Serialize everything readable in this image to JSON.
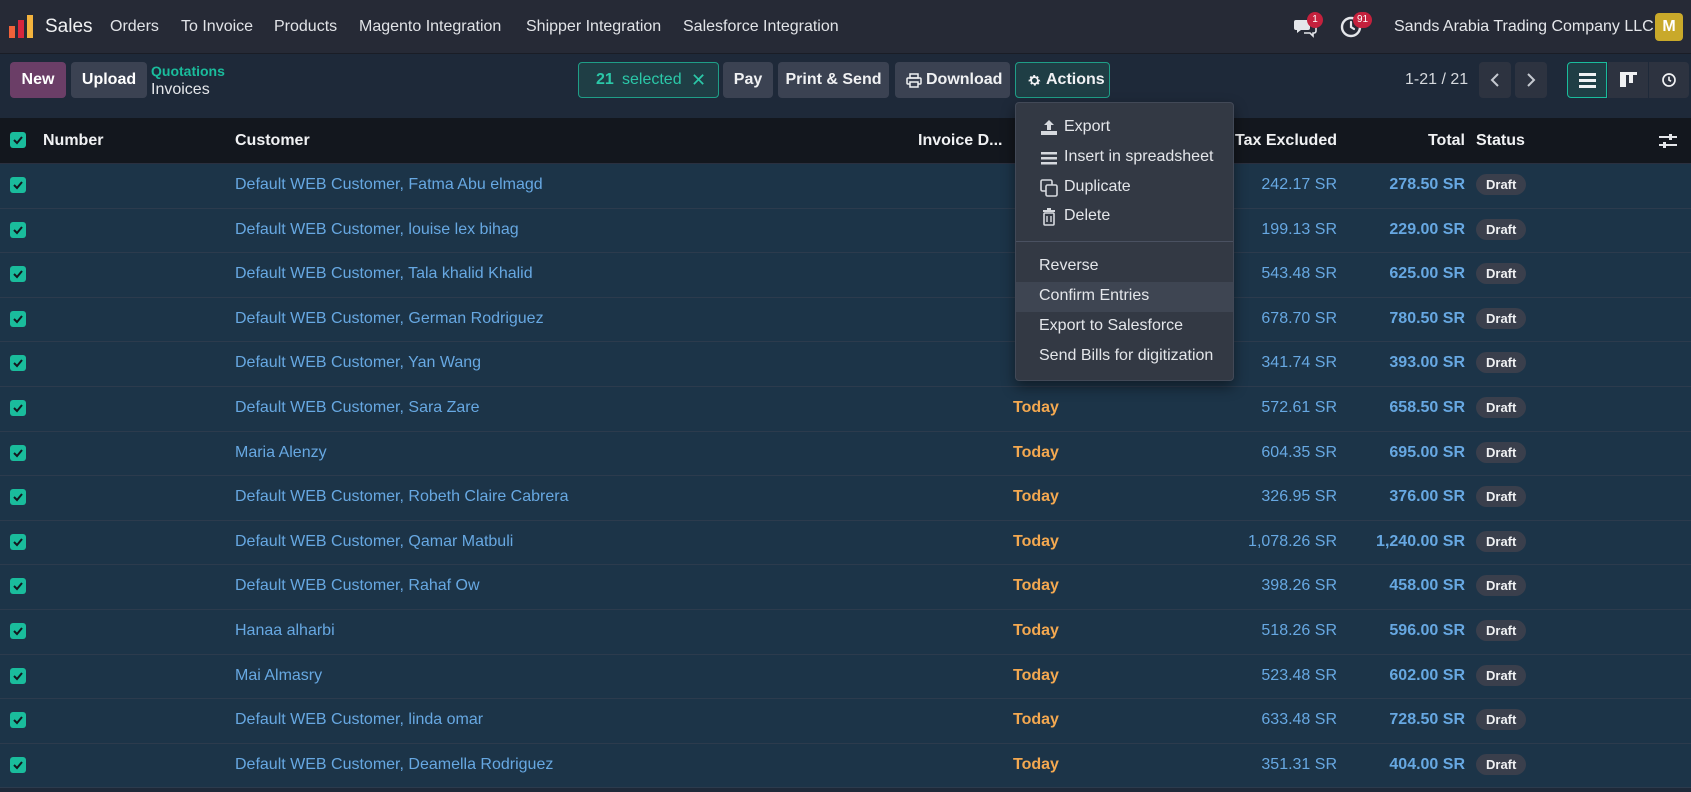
{
  "app": {
    "name": "Sales"
  },
  "menu": [
    "Orders",
    "To Invoice",
    "Products",
    "Magento Integration",
    "Shipper Integration",
    "Salesforce Integration"
  ],
  "systray": {
    "messages_count": "1",
    "activities_count": "91",
    "company": "Sands Arabia Trading Company LLC",
    "avatar_letter": "M"
  },
  "control": {
    "new_label": "New",
    "upload_label": "Upload",
    "breadcrumb_parent": "Quotations",
    "breadcrumb_current": "Invoices",
    "selected_count": "21",
    "selected_text": "selected",
    "clear_icon": "✕",
    "pay_label": "Pay",
    "print_send_label": "Print & Send",
    "download_label": "Download",
    "actions_label": "Actions",
    "pager": "1-21 / 21"
  },
  "columns": {
    "number": "Number",
    "customer": "Customer",
    "invoice_date": "Invoice D...",
    "tax_excluded": "Tax Excluded",
    "total": "Total",
    "status": "Status"
  },
  "rows": [
    {
      "customer": "Default WEB Customer, Fatma Abu elmagd",
      "date": "",
      "tax": "242.17 SR",
      "total": "278.50 SR",
      "status": "Draft"
    },
    {
      "customer": "Default WEB Customer, louise lex bihag",
      "date": "",
      "tax": "199.13 SR",
      "total": "229.00 SR",
      "status": "Draft"
    },
    {
      "customer": "Default WEB Customer, Tala khalid Khalid",
      "date": "",
      "tax": "543.48 SR",
      "total": "625.00 SR",
      "status": "Draft"
    },
    {
      "customer": "Default WEB Customer, German Rodriguez",
      "date": "",
      "tax": "678.70 SR",
      "total": "780.50 SR",
      "status": "Draft"
    },
    {
      "customer": "Default WEB Customer, Yan Wang",
      "date": "",
      "tax": "341.74 SR",
      "total": "393.00 SR",
      "status": "Draft"
    },
    {
      "customer": "Default WEB Customer, Sara Zare",
      "date": "Today",
      "tax": "572.61 SR",
      "total": "658.50 SR",
      "status": "Draft"
    },
    {
      "customer": "Maria Alenzy",
      "date": "Today",
      "tax": "604.35 SR",
      "total": "695.00 SR",
      "status": "Draft"
    },
    {
      "customer": "Default WEB Customer, Robeth Claire Cabrera",
      "date": "Today",
      "tax": "326.95 SR",
      "total": "376.00 SR",
      "status": "Draft"
    },
    {
      "customer": "Default WEB Customer, Qamar Matbuli",
      "date": "Today",
      "tax": "1,078.26 SR",
      "total": "1,240.00 SR",
      "status": "Draft"
    },
    {
      "customer": "Default WEB Customer, Rahaf Ow",
      "date": "Today",
      "tax": "398.26 SR",
      "total": "458.00 SR",
      "status": "Draft"
    },
    {
      "customer": "Hanaa alharbi",
      "date": "Today",
      "tax": "518.26 SR",
      "total": "596.00 SR",
      "status": "Draft"
    },
    {
      "customer": "Mai Almasry",
      "date": "Today",
      "tax": "523.48 SR",
      "total": "602.00 SR",
      "status": "Draft"
    },
    {
      "customer": "Default WEB Customer, linda omar",
      "date": "Today",
      "tax": "633.48 SR",
      "total": "728.50 SR",
      "status": "Draft"
    },
    {
      "customer": "Default WEB Customer, Deamella Rodriguez",
      "date": "Today",
      "tax": "351.31 SR",
      "total": "404.00 SR",
      "status": "Draft"
    }
  ],
  "actions_menu": {
    "group1": [
      {
        "label": "Export",
        "icon": "upload-icon"
      },
      {
        "label": "Insert in spreadsheet",
        "icon": "list-icon"
      },
      {
        "label": "Duplicate",
        "icon": "copy-icon"
      },
      {
        "label": "Delete",
        "icon": "trash-icon"
      }
    ],
    "group2": [
      "Reverse",
      "Confirm Entries",
      "Export to Salesforce",
      "Send Bills for digitization"
    ]
  },
  "colors": {
    "accent": "#1abc9c",
    "link": "#67a8e2",
    "today": "#f3a850",
    "badge": "#c4213d",
    "primary": "#6b3e67"
  }
}
